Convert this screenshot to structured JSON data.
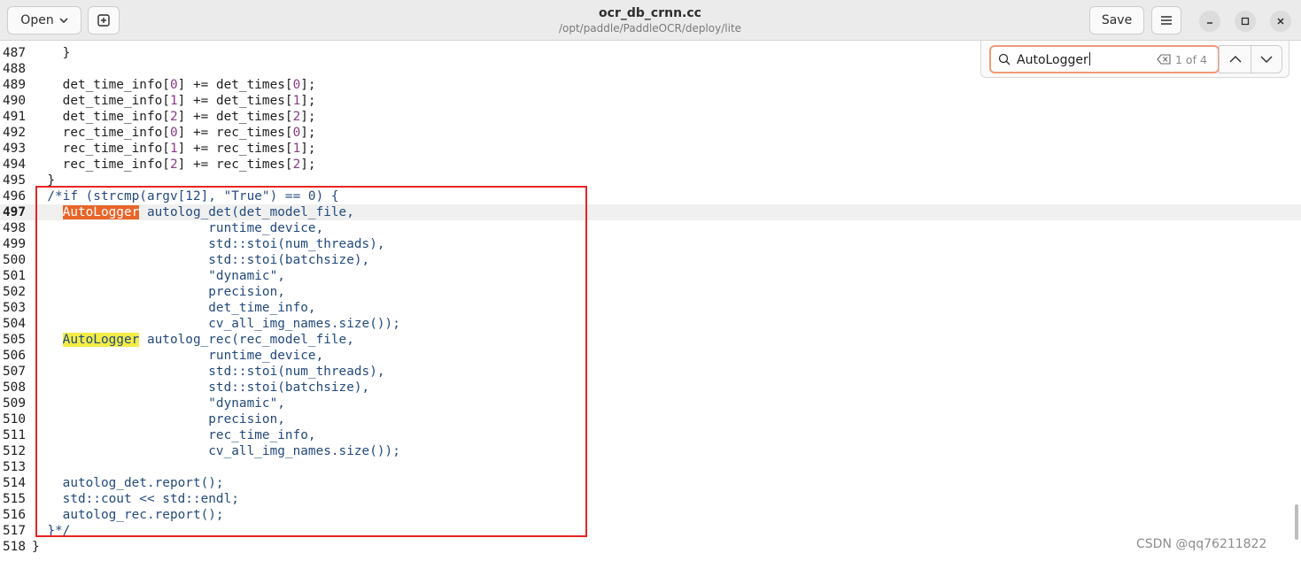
{
  "header": {
    "open_label": "Open",
    "title": "ocr_db_crnn.cc",
    "subtitle": "/opt/paddle/PaddleOCR/deploy/lite",
    "save_label": "Save"
  },
  "search": {
    "query": "AutoLogger",
    "match_count": "1 of 4"
  },
  "watermark": "CSDN @qq76211822",
  "colors": {
    "current_match": "#e9652a",
    "other_match": "#f3ec47",
    "annotation_box": "#e82424"
  },
  "lines": [
    {
      "n": "487",
      "parts": [
        {
          "t": "    }",
          "c": "c-dark"
        }
      ]
    },
    {
      "n": "488",
      "parts": []
    },
    {
      "n": "489",
      "parts": [
        {
          "t": "    det_time_info[",
          "c": "c-dark"
        },
        {
          "t": "0",
          "c": "c-num"
        },
        {
          "t": "] += det_times[",
          "c": "c-dark"
        },
        {
          "t": "0",
          "c": "c-num"
        },
        {
          "t": "];",
          "c": "c-dark"
        }
      ]
    },
    {
      "n": "490",
      "parts": [
        {
          "t": "    det_time_info[",
          "c": "c-dark"
        },
        {
          "t": "1",
          "c": "c-num"
        },
        {
          "t": "] += det_times[",
          "c": "c-dark"
        },
        {
          "t": "1",
          "c": "c-num"
        },
        {
          "t": "];",
          "c": "c-dark"
        }
      ]
    },
    {
      "n": "491",
      "parts": [
        {
          "t": "    det_time_info[",
          "c": "c-dark"
        },
        {
          "t": "2",
          "c": "c-num"
        },
        {
          "t": "] += det_times[",
          "c": "c-dark"
        },
        {
          "t": "2",
          "c": "c-num"
        },
        {
          "t": "];",
          "c": "c-dark"
        }
      ]
    },
    {
      "n": "492",
      "parts": [
        {
          "t": "    rec_time_info[",
          "c": "c-dark"
        },
        {
          "t": "0",
          "c": "c-num"
        },
        {
          "t": "] += rec_times[",
          "c": "c-dark"
        },
        {
          "t": "0",
          "c": "c-num"
        },
        {
          "t": "];",
          "c": "c-dark"
        }
      ]
    },
    {
      "n": "493",
      "parts": [
        {
          "t": "    rec_time_info[",
          "c": "c-dark"
        },
        {
          "t": "1",
          "c": "c-num"
        },
        {
          "t": "] += rec_times[",
          "c": "c-dark"
        },
        {
          "t": "1",
          "c": "c-num"
        },
        {
          "t": "];",
          "c": "c-dark"
        }
      ]
    },
    {
      "n": "494",
      "parts": [
        {
          "t": "    rec_time_info[",
          "c": "c-dark"
        },
        {
          "t": "2",
          "c": "c-num"
        },
        {
          "t": "] += rec_times[",
          "c": "c-dark"
        },
        {
          "t": "2",
          "c": "c-num"
        },
        {
          "t": "];",
          "c": "c-dark"
        }
      ]
    },
    {
      "n": "495",
      "parts": [
        {
          "t": "  }",
          "c": "c-dark"
        }
      ]
    },
    {
      "n": "496",
      "parts": [
        {
          "t": "  /*if (strcmp(argv[12], \"True\") == 0) {",
          "c": "c-blue"
        }
      ]
    },
    {
      "n": "497",
      "current": true,
      "parts": [
        {
          "t": "    ",
          "c": "c-blue"
        },
        {
          "t": "AutoLogger",
          "c": "hl-orange"
        },
        {
          "t": " autolog_det(det_model_file,",
          "c": "c-blue"
        }
      ]
    },
    {
      "n": "498",
      "parts": [
        {
          "t": "                       runtime_device,",
          "c": "c-blue"
        }
      ]
    },
    {
      "n": "499",
      "parts": [
        {
          "t": "                       std::stoi(num_threads),",
          "c": "c-blue"
        }
      ]
    },
    {
      "n": "500",
      "parts": [
        {
          "t": "                       std::stoi(batchsize),",
          "c": "c-blue"
        }
      ]
    },
    {
      "n": "501",
      "parts": [
        {
          "t": "                       \"dynamic\",",
          "c": "c-blue"
        }
      ]
    },
    {
      "n": "502",
      "parts": [
        {
          "t": "                       precision,",
          "c": "c-blue"
        }
      ]
    },
    {
      "n": "503",
      "parts": [
        {
          "t": "                       det_time_info,",
          "c": "c-blue"
        }
      ]
    },
    {
      "n": "504",
      "parts": [
        {
          "t": "                       cv_all_img_names.size());",
          "c": "c-blue"
        }
      ]
    },
    {
      "n": "505",
      "parts": [
        {
          "t": "    ",
          "c": "c-blue"
        },
        {
          "t": "AutoLogger",
          "c": "hl-yellow"
        },
        {
          "t": " autolog_rec(rec_model_file,",
          "c": "c-blue"
        }
      ]
    },
    {
      "n": "506",
      "parts": [
        {
          "t": "                       runtime_device,",
          "c": "c-blue"
        }
      ]
    },
    {
      "n": "507",
      "parts": [
        {
          "t": "                       std::stoi(num_threads),",
          "c": "c-blue"
        }
      ]
    },
    {
      "n": "508",
      "parts": [
        {
          "t": "                       std::stoi(batchsize),",
          "c": "c-blue"
        }
      ]
    },
    {
      "n": "509",
      "parts": [
        {
          "t": "                       \"dynamic\",",
          "c": "c-blue"
        }
      ]
    },
    {
      "n": "510",
      "parts": [
        {
          "t": "                       precision,",
          "c": "c-blue"
        }
      ]
    },
    {
      "n": "511",
      "parts": [
        {
          "t": "                       rec_time_info,",
          "c": "c-blue"
        }
      ]
    },
    {
      "n": "512",
      "parts": [
        {
          "t": "                       cv_all_img_names.size());",
          "c": "c-blue"
        }
      ]
    },
    {
      "n": "513",
      "parts": []
    },
    {
      "n": "514",
      "parts": [
        {
          "t": "    autolog_det.report();",
          "c": "c-blue"
        }
      ]
    },
    {
      "n": "515",
      "parts": [
        {
          "t": "    std::cout << std::endl;",
          "c": "c-blue"
        }
      ]
    },
    {
      "n": "516",
      "parts": [
        {
          "t": "    autolog_rec.report();",
          "c": "c-blue"
        }
      ]
    },
    {
      "n": "517",
      "parts": [
        {
          "t": "  }*/",
          "c": "c-blue"
        }
      ]
    },
    {
      "n": "518",
      "parts": [
        {
          "t": "}",
          "c": "c-dark"
        }
      ]
    }
  ]
}
